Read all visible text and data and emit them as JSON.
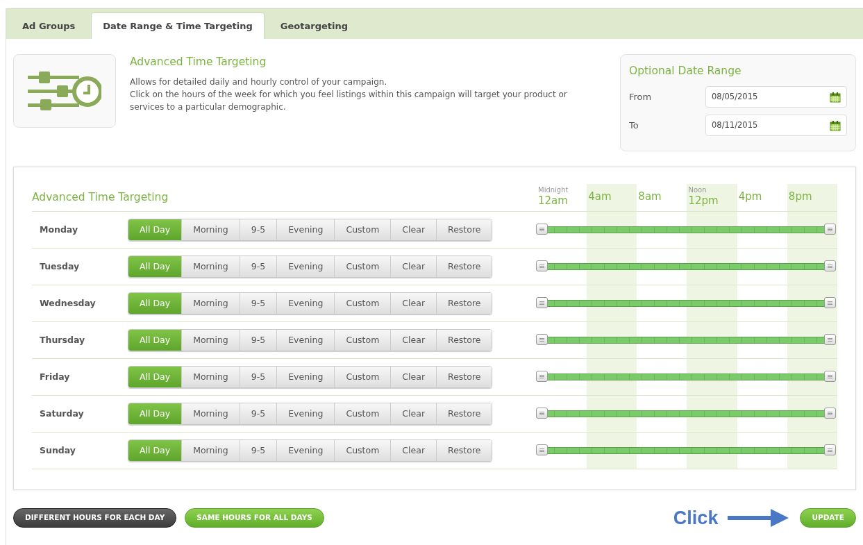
{
  "tabs": [
    {
      "label": "Ad Groups",
      "selected": false
    },
    {
      "label": "Date Range & Time Targeting",
      "selected": true
    },
    {
      "label": "Geotargeting",
      "selected": false
    }
  ],
  "intro": {
    "title": "Advanced Time Targeting",
    "paragraphs": [
      "Allows for detailed daily and hourly control of your campaign.",
      "Click on the hours of the week for which you feel listings within this campaign will target your product or services to a particular demographic."
    ]
  },
  "date_range": {
    "title": "Optional Date Range",
    "fields": [
      {
        "label": "From",
        "value": "08/05/2015"
      },
      {
        "label": "To",
        "value": "08/11/2015"
      }
    ]
  },
  "targeting": {
    "title": "Advanced Time Targeting",
    "hours": [
      {
        "caption": "Midnight",
        "label": "12am"
      },
      {
        "label": "4am"
      },
      {
        "label": "8am"
      },
      {
        "caption": "Noon",
        "label": "12pm"
      },
      {
        "label": "4pm"
      },
      {
        "label": "8pm"
      }
    ],
    "days": [
      {
        "name": "Monday",
        "level": 1,
        "presets": [
          {
            "label": "All Day",
            "selected": true
          },
          {
            "label": "Morning",
            "selected": false
          },
          {
            "label": "9-5",
            "selected": false
          },
          {
            "label": "Evening",
            "selected": false
          },
          {
            "label": "Custom",
            "selected": false
          },
          {
            "label": "Clear",
            "selected": false
          },
          {
            "label": "Restore",
            "selected": false
          }
        ]
      },
      {
        "name": "Tuesday",
        "level": 1,
        "presets": [
          {
            "label": "All Day",
            "selected": true
          },
          {
            "label": "Morning",
            "selected": false
          },
          {
            "label": "9-5",
            "selected": false
          },
          {
            "label": "Evening",
            "selected": false
          },
          {
            "label": "Custom",
            "selected": false
          },
          {
            "label": "Clear",
            "selected": false
          },
          {
            "label": "Restore",
            "selected": false
          }
        ]
      },
      {
        "name": "Wednesday",
        "level": 1,
        "presets": [
          {
            "label": "All Day",
            "selected": true
          },
          {
            "label": "Morning",
            "selected": false
          },
          {
            "label": "9-5",
            "selected": false
          },
          {
            "label": "Evening",
            "selected": false
          },
          {
            "label": "Custom",
            "selected": false
          },
          {
            "label": "Clear",
            "selected": false
          },
          {
            "label": "Restore",
            "selected": false
          }
        ]
      },
      {
        "name": "Thursday",
        "level": 1,
        "presets": [
          {
            "label": "All Day",
            "selected": true
          },
          {
            "label": "Morning",
            "selected": false
          },
          {
            "label": "9-5",
            "selected": false
          },
          {
            "label": "Evening",
            "selected": false
          },
          {
            "label": "Custom",
            "selected": false
          },
          {
            "label": "Clear",
            "selected": false
          },
          {
            "label": "Restore",
            "selected": false
          }
        ]
      },
      {
        "name": "Friday",
        "level": 1,
        "presets": [
          {
            "label": "All Day",
            "selected": true
          },
          {
            "label": "Morning",
            "selected": false
          },
          {
            "label": "9-5",
            "selected": false
          },
          {
            "label": "Evening",
            "selected": false
          },
          {
            "label": "Custom",
            "selected": false
          },
          {
            "label": "Clear",
            "selected": false
          },
          {
            "label": "Restore",
            "selected": false
          }
        ]
      },
      {
        "name": "Saturday",
        "level": 1,
        "presets": [
          {
            "label": "All Day",
            "selected": true
          },
          {
            "label": "Morning",
            "selected": false
          },
          {
            "label": "9-5",
            "selected": false
          },
          {
            "label": "Evening",
            "selected": false
          },
          {
            "label": "Custom",
            "selected": false
          },
          {
            "label": "Clear",
            "selected": false
          },
          {
            "label": "Restore",
            "selected": false
          }
        ]
      },
      {
        "name": "Sunday",
        "level": 1,
        "presets": [
          {
            "label": "All Day",
            "selected": true
          },
          {
            "label": "Morning",
            "selected": false
          },
          {
            "label": "9-5",
            "selected": false
          },
          {
            "label": "Evening",
            "selected": false
          },
          {
            "label": "Custom",
            "selected": false
          },
          {
            "label": "Clear",
            "selected": false
          },
          {
            "label": "Restore",
            "selected": false
          }
        ]
      }
    ]
  },
  "footer": {
    "buttons": [
      {
        "label": "DIFFERENT HOURS FOR EACH DAY",
        "kind": "dark"
      },
      {
        "label": "SAME HOURS FOR ALL DAYS",
        "kind": "green"
      }
    ],
    "hint": "Click",
    "update": "UPDATE"
  }
}
